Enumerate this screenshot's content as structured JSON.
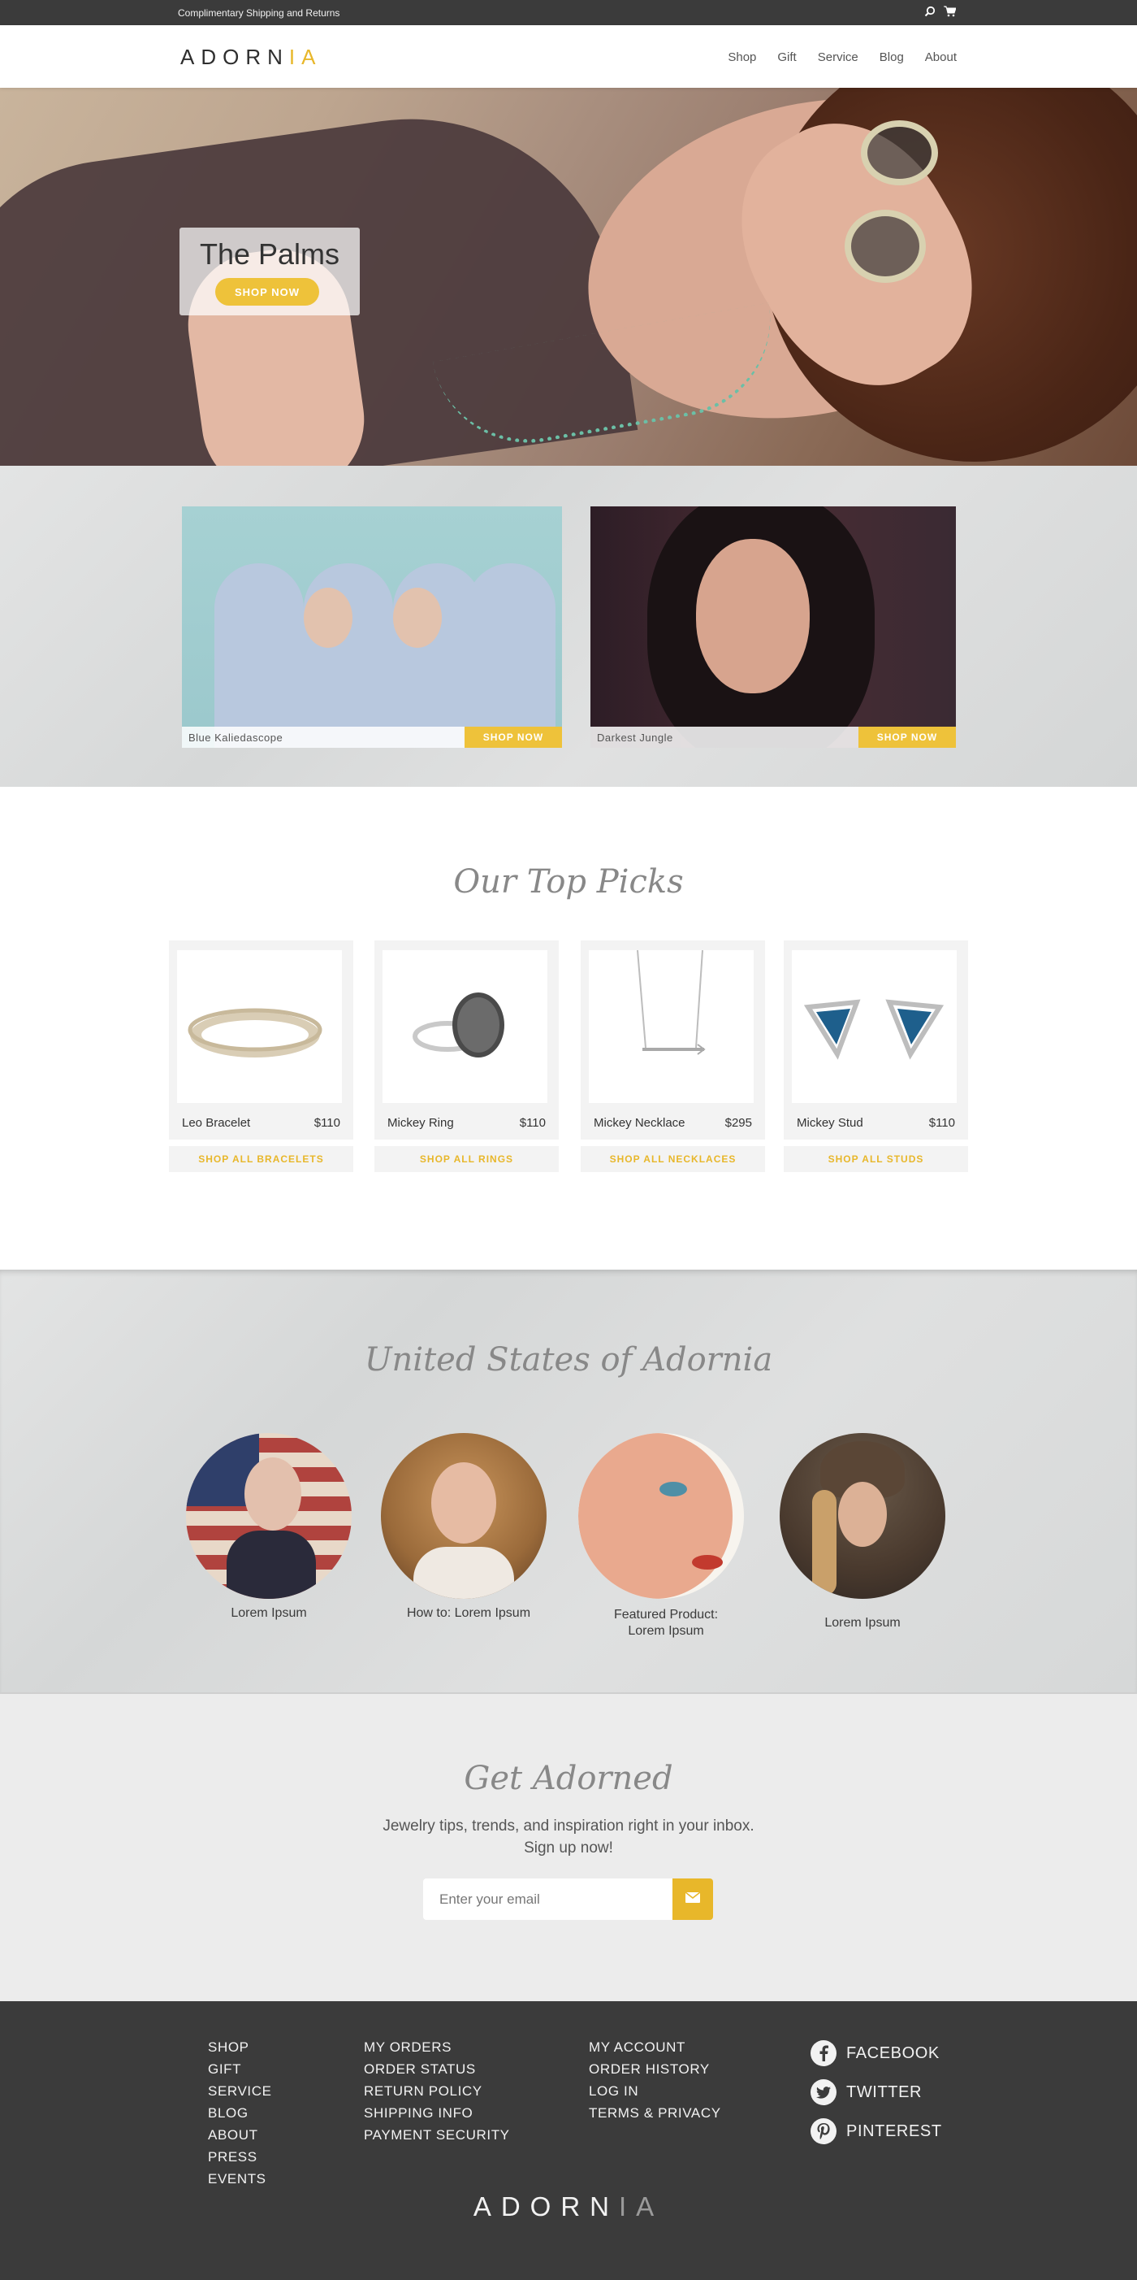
{
  "topbar": {
    "promo": "Complimentary Shipping and Returns",
    "icons": [
      "search-icon",
      "cart-icon"
    ]
  },
  "header": {
    "logo_main": "ADORN",
    "logo_accent": "IA",
    "nav": [
      "Shop",
      "Gift",
      "Service",
      "Blog",
      "About"
    ]
  },
  "hero": {
    "title": "The Palms",
    "cta": "SHOP NOW"
  },
  "promos": [
    {
      "label": "Blue Kaliedascope",
      "cta": "SHOP NOW"
    },
    {
      "label": "Darkest Jungle",
      "cta": "SHOP NOW"
    }
  ],
  "top_picks": {
    "title": "Our Top Picks",
    "products": [
      {
        "name": "Leo Bracelet",
        "price": "$110",
        "link": "SHOP ALL BRACELETS"
      },
      {
        "name": "Mickey Ring",
        "price": "$110",
        "link": "SHOP ALL RINGS"
      },
      {
        "name": "Mickey Necklace",
        "price": "$295",
        "link": "SHOP ALL NECKLACES"
      },
      {
        "name": "Mickey Stud",
        "price": "$110",
        "link": "SHOP ALL STUDS"
      }
    ]
  },
  "community": {
    "title": "United States of Adornia",
    "items": [
      {
        "caption": "Lorem Ipsum"
      },
      {
        "caption": "How to: Lorem Ipsum"
      },
      {
        "caption_line1": "Featured Product:",
        "caption_line2": "Lorem Ipsum"
      },
      {
        "caption": "Lorem Ipsum"
      }
    ]
  },
  "newsletter": {
    "title": "Get Adorned",
    "subtitle": "Jewelry tips, trends, and inspiration right in your inbox. Sign up now!",
    "placeholder": "Enter your email"
  },
  "footer": {
    "col1": [
      "SHOP",
      "GIFT",
      "SERVICE",
      "BLOG",
      "ABOUT",
      "PRESS",
      "EVENTS"
    ],
    "col2": [
      "MY ORDERS",
      "ORDER STATUS",
      "RETURN POLICY",
      "SHIPPING INFO",
      "PAYMENT SECURITY"
    ],
    "col3": [
      "MY ACCOUNT",
      "ORDER HISTORY",
      "LOG IN",
      "TERMS & PRIVACY"
    ],
    "social": [
      "FACEBOOK",
      "TWITTER",
      "PINTEREST"
    ],
    "logo_main": "ADORN",
    "logo_accent": "IA"
  },
  "colors": {
    "accent": "#e8b72a",
    "dark": "#3b3b3b",
    "light_gray": "#ececec"
  }
}
